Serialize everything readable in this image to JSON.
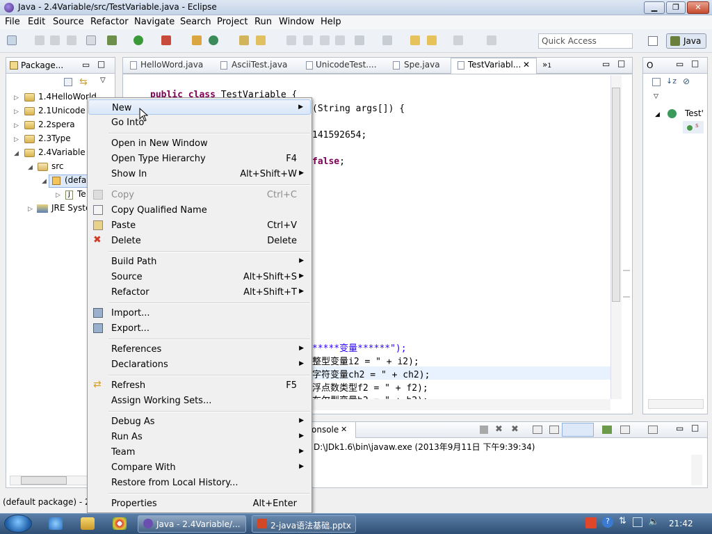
{
  "window": {
    "title": "Java - 2.4Variable/src/TestVariable.java - Eclipse"
  },
  "menubar": [
    "File",
    "Edit",
    "Source",
    "Refactor",
    "Navigate",
    "Search",
    "Project",
    "Run",
    "Window",
    "Help"
  ],
  "toolbar": {
    "quick_access_placeholder": "Quick Access",
    "perspective_label": "Java"
  },
  "package_explorer": {
    "tab_label": "Package...",
    "tree": [
      {
        "label": "1.4HelloWorld"
      },
      {
        "label": "2.1Unicode"
      },
      {
        "label": "2.2spera"
      },
      {
        "label": "2.3Type"
      },
      {
        "label": "2.4Variable"
      },
      {
        "label": "src"
      },
      {
        "label": "(defa"
      },
      {
        "label": "Te"
      },
      {
        "label": "JRE Syste"
      }
    ]
  },
  "editor": {
    "tabs": [
      "HelloWord.java",
      "AsciiTest.java",
      "UnicodeTest....",
      "Spe.java",
      "TestVariabl..."
    ],
    "overflow_count": "1",
    "code": {
      "l1_kw": "public class",
      "l1_rest": " TestVariable {",
      "l2": "(String args[]) {",
      "l3": "141592654;",
      "l4": "false",
      "l4_end": ";",
      "l5": "*****变量******\");",
      "l6": "整型变量i2 = \" + i2);",
      "l7": "字符变量ch2 = \" + ch2);",
      "l8": "浮点数类型f2 = \" + f2);",
      "l9": "布尔型变量b2 = \" + b2);"
    }
  },
  "outline": {
    "tab_label": "O",
    "item": "Test'",
    "sub": "s"
  },
  "console": {
    "tab_label": "onsole",
    "line": "D:\\JDk1.6\\bin\\javaw.exe (2013年9月11日 下午9:39:34)"
  },
  "statusbar": {
    "text": "(default package) - 2"
  },
  "context_menu": {
    "items": [
      {
        "label": "New",
        "shortcut": "",
        "submenu": true
      },
      {
        "label": "Go Into",
        "shortcut": ""
      },
      {
        "label": "Open in New Window",
        "shortcut": ""
      },
      {
        "label": "Open Type Hierarchy",
        "shortcut": "F4"
      },
      {
        "label": "Show In",
        "shortcut": "Alt+Shift+W",
        "submenu": true
      },
      {
        "label": "Copy",
        "shortcut": "Ctrl+C",
        "disabled": true
      },
      {
        "label": "Copy Qualified Name",
        "shortcut": ""
      },
      {
        "label": "Paste",
        "shortcut": "Ctrl+V"
      },
      {
        "label": "Delete",
        "shortcut": "Delete"
      },
      {
        "label": "Build Path",
        "shortcut": "",
        "submenu": true
      },
      {
        "label": "Source",
        "shortcut": "Alt+Shift+S",
        "submenu": true
      },
      {
        "label": "Refactor",
        "shortcut": "Alt+Shift+T",
        "submenu": true
      },
      {
        "label": "Import...",
        "shortcut": ""
      },
      {
        "label": "Export...",
        "shortcut": ""
      },
      {
        "label": "References",
        "shortcut": "",
        "submenu": true
      },
      {
        "label": "Declarations",
        "shortcut": "",
        "submenu": true
      },
      {
        "label": "Refresh",
        "shortcut": "F5"
      },
      {
        "label": "Assign Working Sets...",
        "shortcut": ""
      },
      {
        "label": "Debug As",
        "shortcut": "",
        "submenu": true
      },
      {
        "label": "Run As",
        "shortcut": "",
        "submenu": true
      },
      {
        "label": "Team",
        "shortcut": "",
        "submenu": true
      },
      {
        "label": "Compare With",
        "shortcut": "",
        "submenu": true
      },
      {
        "label": "Restore from Local History...",
        "shortcut": ""
      },
      {
        "label": "Properties",
        "shortcut": "Alt+Enter"
      }
    ]
  },
  "taskbar": {
    "tasks": [
      "Java - 2.4Variable/...",
      "2-java语法基础.pptx"
    ],
    "clock": "21:42"
  }
}
